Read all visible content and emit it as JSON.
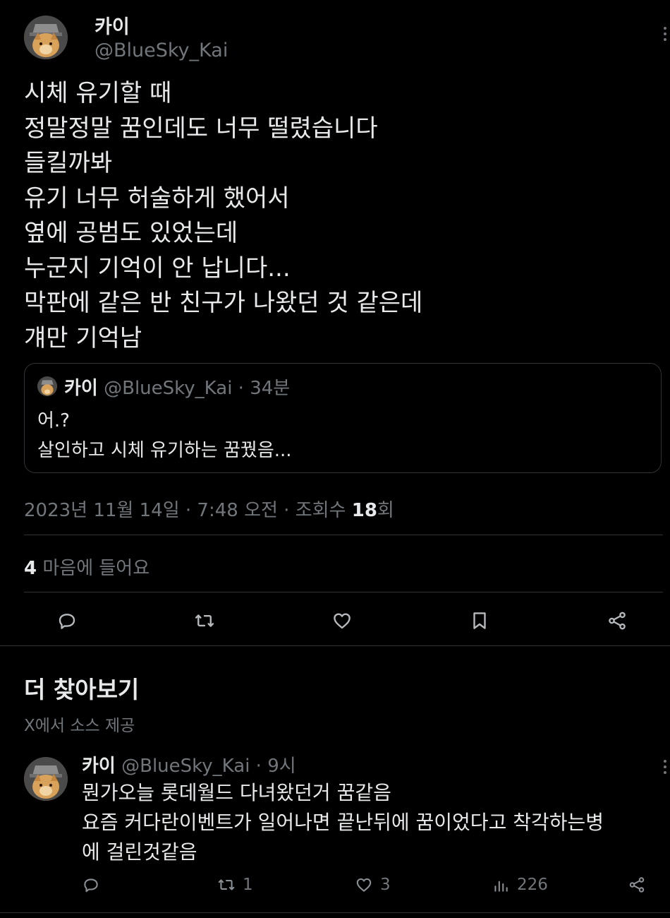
{
  "tweet": {
    "author_name": "카이",
    "author_handle": "@BlueSky_Kai",
    "text_lines": [
      "시체 유기할 때",
      "정말정말 꿈인데도 너무 떨렸습니다",
      "들킬까봐",
      "유기 너무 허술하게 했어서",
      "옆에 공범도 있었는데",
      "누군지 기억이 안 납니다...",
      "막판에 같은 반 친구가 나왔던 것 같은데",
      "걔만 기억남"
    ],
    "quote": {
      "name": "카이",
      "meta": "@BlueSky_Kai · 34분",
      "text_lines": [
        "어.?",
        "살인하고 시체 유기하는 꿈꿨음..."
      ]
    },
    "timestamp": "2023년 11월 14일 · 7:48 오전 · 조회수 ",
    "views": "18",
    "views_suffix": "회",
    "likes_count": "4",
    "likes_label": " 마음에 들어요"
  },
  "discover": {
    "title": "더 찾아보기",
    "subtitle": "X에서 소스 제공"
  },
  "reply": {
    "name": "카이",
    "meta": " @BlueSky_Kai · 9시",
    "text_lines": [
      "뭔가오늘 롯데월드 다녀왔던거 꿈같음",
      "요즘 커다란이벤트가 일어나면 끝난뒤에 꿈이었다고 착각하는병",
      "에 걸린것같음"
    ],
    "retweets": "1",
    "likes": "3",
    "views": "226"
  },
  "icons": {
    "reply": "reply-icon",
    "retweet": "retweet-icon",
    "like": "heart-icon",
    "bookmark": "bookmark-icon",
    "share": "share-icon",
    "views": "views-icon",
    "more": "more-icon"
  },
  "colors": {
    "background": "#000000",
    "text": "#e7e9ea",
    "secondary": "#71767b",
    "border": "#2f3336"
  }
}
